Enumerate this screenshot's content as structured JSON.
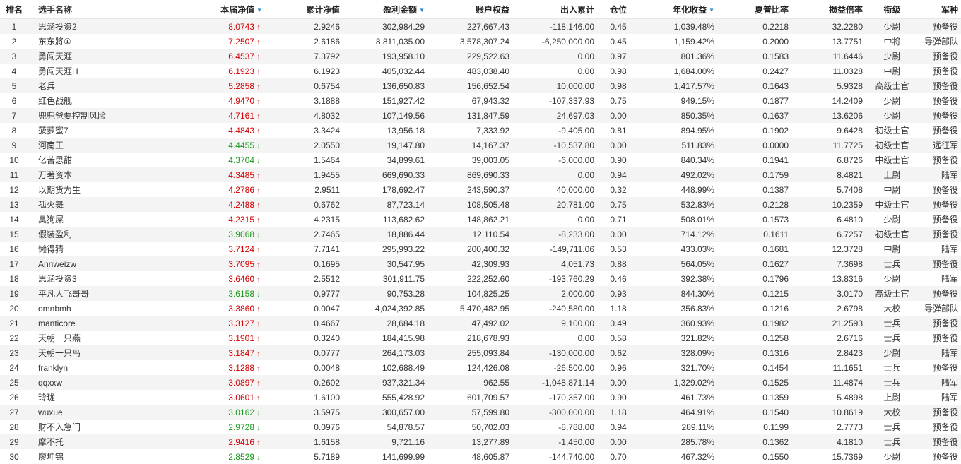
{
  "headers": [
    {
      "key": "rank",
      "label": "排名",
      "sort": false
    },
    {
      "key": "name",
      "label": "选手名称",
      "sort": false
    },
    {
      "key": "cur_nav",
      "label": "本届净值",
      "sort": true
    },
    {
      "key": "cum_nav",
      "label": "累计净值",
      "sort": false
    },
    {
      "key": "profit",
      "label": "盈利金额",
      "sort": true
    },
    {
      "key": "equity",
      "label": "账户权益",
      "sort": false
    },
    {
      "key": "flow",
      "label": "出入累计",
      "sort": false
    },
    {
      "key": "position",
      "label": "仓位",
      "sort": false
    },
    {
      "key": "annual",
      "label": "年化收益",
      "sort": true
    },
    {
      "key": "sharpe",
      "label": "夏普比率",
      "sort": false
    },
    {
      "key": "pl_ratio",
      "label": "损益倍率",
      "sort": false
    },
    {
      "key": "rank_title",
      "label": "衔级",
      "sort": false
    },
    {
      "key": "branch",
      "label": "军种",
      "sort": false
    }
  ],
  "sort_icon": "sort-desc-icon",
  "colors": {
    "up": "#d40000",
    "down": "#1a9a1a",
    "sort": "#2a8ad4"
  },
  "rows": [
    {
      "rank": "1",
      "name": "思涵投资2",
      "cur_nav": "8.0743",
      "dir": "up",
      "cum_nav": "2.9246",
      "profit": "302,984.29",
      "equity": "227,667.43",
      "flow": "-118,146.00",
      "position": "0.45",
      "annual": "1,039.48%",
      "sharpe": "0.2218",
      "pl_ratio": "32.2280",
      "rank_title": "少尉",
      "branch": "预备役"
    },
    {
      "rank": "2",
      "name": "东东將①",
      "cur_nav": "7.2507",
      "dir": "up",
      "cum_nav": "2.6186",
      "profit": "8,811,035.00",
      "equity": "3,578,307.24",
      "flow": "-6,250,000.00",
      "position": "0.45",
      "annual": "1,159.42%",
      "sharpe": "0.2000",
      "pl_ratio": "13.7751",
      "rank_title": "中将",
      "branch": "导弹部队"
    },
    {
      "rank": "3",
      "name": "勇闯天涯",
      "cur_nav": "6.4537",
      "dir": "up",
      "cum_nav": "7.3792",
      "profit": "193,958.10",
      "equity": "229,522.63",
      "flow": "0.00",
      "position": "0.97",
      "annual": "801.36%",
      "sharpe": "0.1583",
      "pl_ratio": "11.6446",
      "rank_title": "少尉",
      "branch": "预备役"
    },
    {
      "rank": "4",
      "name": "勇闯天涯H",
      "cur_nav": "6.1923",
      "dir": "up",
      "cum_nav": "6.1923",
      "profit": "405,032.44",
      "equity": "483,038.40",
      "flow": "0.00",
      "position": "0.98",
      "annual": "1,684.00%",
      "sharpe": "0.2427",
      "pl_ratio": "11.0328",
      "rank_title": "中尉",
      "branch": "预备役"
    },
    {
      "rank": "5",
      "name": "老兵",
      "cur_nav": "5.2858",
      "dir": "up",
      "cum_nav": "0.6754",
      "profit": "136,650.83",
      "equity": "156,652.54",
      "flow": "10,000.00",
      "position": "0.98",
      "annual": "1,417.57%",
      "sharpe": "0.1643",
      "pl_ratio": "5.9328",
      "rank_title": "高级士官",
      "branch": "预备役"
    },
    {
      "rank": "6",
      "name": "红色战舰",
      "cur_nav": "4.9470",
      "dir": "up",
      "cum_nav": "3.1888",
      "profit": "151,927.42",
      "equity": "67,943.32",
      "flow": "-107,337.93",
      "position": "0.75",
      "annual": "949.15%",
      "sharpe": "0.1877",
      "pl_ratio": "14.2409",
      "rank_title": "少尉",
      "branch": "预备役"
    },
    {
      "rank": "7",
      "name": "兜兜爸要控制风险",
      "cur_nav": "4.7161",
      "dir": "up",
      "cum_nav": "4.8032",
      "profit": "107,149.56",
      "equity": "131,847.59",
      "flow": "24,697.03",
      "position": "0.00",
      "annual": "850.35%",
      "sharpe": "0.1637",
      "pl_ratio": "13.6206",
      "rank_title": "少尉",
      "branch": "预备役"
    },
    {
      "rank": "8",
      "name": "菠萝蜜7",
      "cur_nav": "4.4843",
      "dir": "up",
      "cum_nav": "3.3424",
      "profit": "13,956.18",
      "equity": "7,333.92",
      "flow": "-9,405.00",
      "position": "0.81",
      "annual": "894.95%",
      "sharpe": "0.1902",
      "pl_ratio": "9.6428",
      "rank_title": "初级士官",
      "branch": "预备役"
    },
    {
      "rank": "9",
      "name": "河南王",
      "cur_nav": "4.4455",
      "dir": "down",
      "cum_nav": "2.0550",
      "profit": "19,147.80",
      "equity": "14,167.37",
      "flow": "-10,537.80",
      "position": "0.00",
      "annual": "511.83%",
      "sharpe": "0.0000",
      "pl_ratio": "11.7725",
      "rank_title": "初级士官",
      "branch": "远征军"
    },
    {
      "rank": "10",
      "name": "亿苦思甜",
      "cur_nav": "4.3704",
      "dir": "down",
      "cum_nav": "1.5464",
      "profit": "34,899.61",
      "equity": "39,003.05",
      "flow": "-6,000.00",
      "position": "0.90",
      "annual": "840.34%",
      "sharpe": "0.1941",
      "pl_ratio": "6.8726",
      "rank_title": "中级士官",
      "branch": "预备役"
    },
    {
      "rank": "11",
      "name": "万著资本",
      "cur_nav": "4.3485",
      "dir": "up",
      "cum_nav": "1.9455",
      "profit": "669,690.33",
      "equity": "869,690.33",
      "flow": "0.00",
      "position": "0.94",
      "annual": "492.02%",
      "sharpe": "0.1759",
      "pl_ratio": "8.4821",
      "rank_title": "上尉",
      "branch": "陆军"
    },
    {
      "rank": "12",
      "name": "以期货为生",
      "cur_nav": "4.2786",
      "dir": "up",
      "cum_nav": "2.9511",
      "profit": "178,692.47",
      "equity": "243,590.37",
      "flow": "40,000.00",
      "position": "0.32",
      "annual": "448.99%",
      "sharpe": "0.1387",
      "pl_ratio": "5.7408",
      "rank_title": "中尉",
      "branch": "预备役"
    },
    {
      "rank": "13",
      "name": "孤火舞",
      "cur_nav": "4.2488",
      "dir": "up",
      "cum_nav": "0.6762",
      "profit": "87,723.14",
      "equity": "108,505.48",
      "flow": "20,781.00",
      "position": "0.75",
      "annual": "532.83%",
      "sharpe": "0.2128",
      "pl_ratio": "10.2359",
      "rank_title": "中级士官",
      "branch": "预备役"
    },
    {
      "rank": "14",
      "name": "臭狗屎",
      "cur_nav": "4.2315",
      "dir": "up",
      "cum_nav": "4.2315",
      "profit": "113,682.62",
      "equity": "148,862.21",
      "flow": "0.00",
      "position": "0.71",
      "annual": "508.01%",
      "sharpe": "0.1573",
      "pl_ratio": "6.4810",
      "rank_title": "少尉",
      "branch": "预备役"
    },
    {
      "rank": "15",
      "name": "假装盈利",
      "cur_nav": "3.9068",
      "dir": "down",
      "cum_nav": "2.7465",
      "profit": "18,886.44",
      "equity": "12,110.54",
      "flow": "-8,233.00",
      "position": "0.00",
      "annual": "714.12%",
      "sharpe": "0.1611",
      "pl_ratio": "6.7257",
      "rank_title": "初级士官",
      "branch": "预备役"
    },
    {
      "rank": "16",
      "name": "懒得猜",
      "cur_nav": "3.7124",
      "dir": "up",
      "cum_nav": "7.7141",
      "profit": "295,993.22",
      "equity": "200,400.32",
      "flow": "-149,711.06",
      "position": "0.53",
      "annual": "433.03%",
      "sharpe": "0.1681",
      "pl_ratio": "12.3728",
      "rank_title": "中尉",
      "branch": "陆军"
    },
    {
      "rank": "17",
      "name": "Annweizw",
      "cur_nav": "3.7095",
      "dir": "up",
      "cum_nav": "0.1695",
      "profit": "30,547.95",
      "equity": "42,309.93",
      "flow": "4,051.73",
      "position": "0.88",
      "annual": "564.05%",
      "sharpe": "0.1627",
      "pl_ratio": "7.3698",
      "rank_title": "士兵",
      "branch": "预备役"
    },
    {
      "rank": "18",
      "name": "思涵投资3",
      "cur_nav": "3.6460",
      "dir": "up",
      "cum_nav": "2.5512",
      "profit": "301,911.75",
      "equity": "222,252.60",
      "flow": "-193,760.29",
      "position": "0.46",
      "annual": "392.38%",
      "sharpe": "0.1796",
      "pl_ratio": "13.8316",
      "rank_title": "少尉",
      "branch": "陆军"
    },
    {
      "rank": "19",
      "name": "平凡人飞哥哥",
      "cur_nav": "3.6158",
      "dir": "down",
      "cum_nav": "0.9777",
      "profit": "90,753.28",
      "equity": "104,825.25",
      "flow": "2,000.00",
      "position": "0.93",
      "annual": "844.30%",
      "sharpe": "0.1215",
      "pl_ratio": "3.0170",
      "rank_title": "高级士官",
      "branch": "预备役"
    },
    {
      "rank": "20",
      "name": "omnbmh",
      "cur_nav": "3.3860",
      "dir": "up",
      "cum_nav": "0.0047",
      "profit": "4,024,392.85",
      "equity": "5,470,482.95",
      "flow": "-240,580.00",
      "position": "1.18",
      "annual": "356.83%",
      "sharpe": "0.1216",
      "pl_ratio": "2.6798",
      "rank_title": "大校",
      "branch": "导弹部队"
    },
    {
      "rank": "21",
      "name": "manticore",
      "cur_nav": "3.3127",
      "dir": "up",
      "cum_nav": "0.4667",
      "profit": "28,684.18",
      "equity": "47,492.02",
      "flow": "9,100.00",
      "position": "0.49",
      "annual": "360.93%",
      "sharpe": "0.1982",
      "pl_ratio": "21.2593",
      "rank_title": "士兵",
      "branch": "预备役"
    },
    {
      "rank": "22",
      "name": "天朝一只燕",
      "cur_nav": "3.1901",
      "dir": "up",
      "cum_nav": "0.3240",
      "profit": "184,415.98",
      "equity": "218,678.93",
      "flow": "0.00",
      "position": "0.58",
      "annual": "321.82%",
      "sharpe": "0.1258",
      "pl_ratio": "2.6716",
      "rank_title": "士兵",
      "branch": "预备役"
    },
    {
      "rank": "23",
      "name": "天朝一只鸟",
      "cur_nav": "3.1847",
      "dir": "up",
      "cum_nav": "0.0777",
      "profit": "264,173.03",
      "equity": "255,093.84",
      "flow": "-130,000.00",
      "position": "0.62",
      "annual": "328.09%",
      "sharpe": "0.1316",
      "pl_ratio": "2.8423",
      "rank_title": "少尉",
      "branch": "陆军"
    },
    {
      "rank": "24",
      "name": "franklyn",
      "cur_nav": "3.1288",
      "dir": "up",
      "cum_nav": "0.0048",
      "profit": "102,688.49",
      "equity": "124,426.08",
      "flow": "-26,500.00",
      "position": "0.96",
      "annual": "321.70%",
      "sharpe": "0.1454",
      "pl_ratio": "11.1651",
      "rank_title": "士兵",
      "branch": "预备役"
    },
    {
      "rank": "25",
      "name": "qqxxw",
      "cur_nav": "3.0897",
      "dir": "up",
      "cum_nav": "0.2602",
      "profit": "937,321.34",
      "equity": "962.55",
      "flow": "-1,048,871.14",
      "position": "0.00",
      "annual": "1,329.02%",
      "sharpe": "0.1525",
      "pl_ratio": "11.4874",
      "rank_title": "士兵",
      "branch": "陆军"
    },
    {
      "rank": "26",
      "name": "玲珑",
      "cur_nav": "3.0601",
      "dir": "up",
      "cum_nav": "1.6100",
      "profit": "555,428.92",
      "equity": "601,709.57",
      "flow": "-170,357.00",
      "position": "0.90",
      "annual": "461.73%",
      "sharpe": "0.1359",
      "pl_ratio": "5.4898",
      "rank_title": "上尉",
      "branch": "陆军"
    },
    {
      "rank": "27",
      "name": "wuxue",
      "cur_nav": "3.0162",
      "dir": "down",
      "cum_nav": "3.5975",
      "profit": "300,657.00",
      "equity": "57,599.80",
      "flow": "-300,000.00",
      "position": "1.18",
      "annual": "464.91%",
      "sharpe": "0.1540",
      "pl_ratio": "10.8619",
      "rank_title": "大校",
      "branch": "预备役"
    },
    {
      "rank": "28",
      "name": "财不入急门",
      "cur_nav": "2.9728",
      "dir": "down",
      "cum_nav": "0.0976",
      "profit": "54,878.57",
      "equity": "50,702.03",
      "flow": "-8,788.00",
      "position": "0.94",
      "annual": "289.11%",
      "sharpe": "0.1199",
      "pl_ratio": "2.7773",
      "rank_title": "士兵",
      "branch": "预备役"
    },
    {
      "rank": "29",
      "name": "摩不托",
      "cur_nav": "2.9416",
      "dir": "up",
      "cum_nav": "1.6158",
      "profit": "9,721.16",
      "equity": "13,277.89",
      "flow": "-1,450.00",
      "position": "0.00",
      "annual": "285.78%",
      "sharpe": "0.1362",
      "pl_ratio": "4.1810",
      "rank_title": "士兵",
      "branch": "预备役"
    },
    {
      "rank": "30",
      "name": "廖坤锦",
      "cur_nav": "2.8529",
      "dir": "down",
      "cum_nav": "5.7189",
      "profit": "141,699.99",
      "equity": "48,605.87",
      "flow": "-144,740.00",
      "position": "0.70",
      "annual": "467.32%",
      "sharpe": "0.1550",
      "pl_ratio": "15.7369",
      "rank_title": "少尉",
      "branch": "预备役"
    }
  ]
}
